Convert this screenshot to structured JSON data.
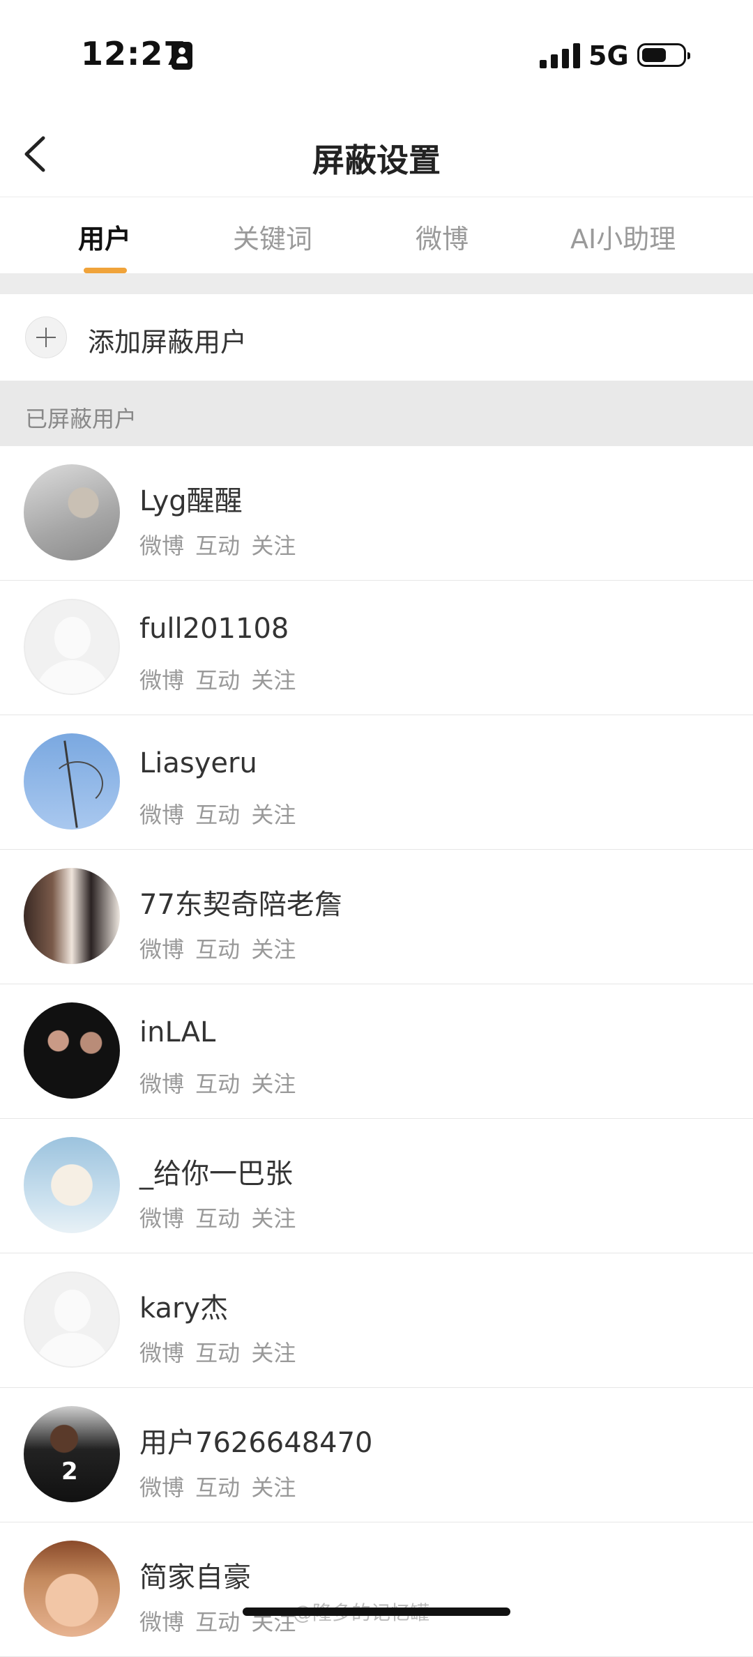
{
  "status_bar": {
    "time": "12:27",
    "network": "5G"
  },
  "nav": {
    "title": "屏蔽设置"
  },
  "tabs": [
    {
      "label": "用户",
      "active": true
    },
    {
      "label": "关键词",
      "active": false
    },
    {
      "label": "微博",
      "active": false
    },
    {
      "label": "AI小助理",
      "active": false
    }
  ],
  "add": {
    "label": "添加屏蔽用户"
  },
  "section": {
    "label": "已屏蔽用户"
  },
  "users": [
    {
      "name": "Lyg醒醒",
      "scope": "微博 互动 关注",
      "avatar": "cat-avatar"
    },
    {
      "name": "full201108",
      "scope": "微博 互动 关注",
      "avatar": "default-avatar"
    },
    {
      "name": "Liasyeru",
      "scope": "微博 互动 关注",
      "avatar": "sky-avatar"
    },
    {
      "name": "77东契奇陪老詹",
      "scope": "微博 互动 关注",
      "avatar": "couple-avatar"
    },
    {
      "name": "inLAL",
      "scope": "微博 互动 关注",
      "avatar": "photo-avatar"
    },
    {
      "name": "_给你一巴张",
      "scope": "微博 互动 关注",
      "avatar": "polar-bear-avatar"
    },
    {
      "name": "kary杰",
      "scope": "微博 互动 关注",
      "avatar": "default-avatar"
    },
    {
      "name": "用户7626648470",
      "scope": "微博 互动 关注",
      "avatar": "player-avatar"
    },
    {
      "name": "简家自豪",
      "scope": "微博 互动 关注",
      "avatar": "face-avatar"
    }
  ],
  "watermark": "@隆多的记忆罐",
  "colors": {
    "accent": "#f0a33a",
    "section_bg": "#e9e9e9"
  }
}
